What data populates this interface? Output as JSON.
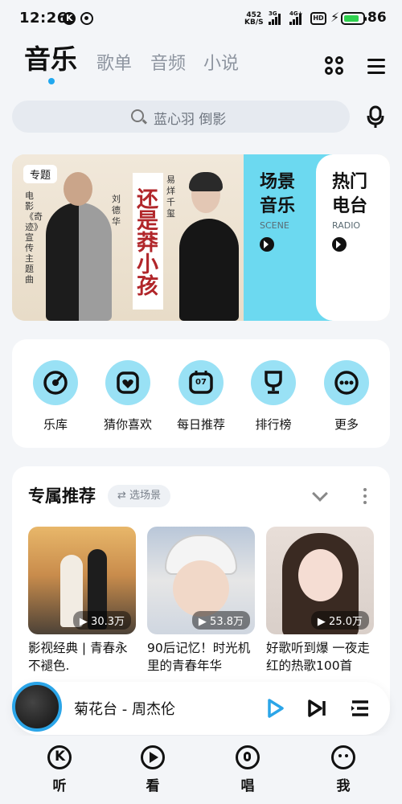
{
  "status_bar": {
    "time": "12:26",
    "speed_value": "452",
    "speed_unit": "KB/S",
    "net1": "3G",
    "net2": "4G+",
    "hd": "HD",
    "battery_percent": "86"
  },
  "top_tabs": [
    {
      "label": "音乐",
      "active": true
    },
    {
      "label": "歌单",
      "active": false
    },
    {
      "label": "音频",
      "active": false
    },
    {
      "label": "小说",
      "active": false
    }
  ],
  "search": {
    "placeholder": "蓝心羽 倒影"
  },
  "banner": {
    "badge": "专题",
    "vertical_caption": "电影《奇迹》宣传主题曲",
    "title": "还是莽小孩",
    "name_left": "刘德华",
    "name_right": "易烊千玺"
  },
  "categories": [
    {
      "title_line1": "场景",
      "title_line2": "音乐",
      "subtitle": "SCENE"
    },
    {
      "title_line1": "热门",
      "title_line2": "电台",
      "subtitle": "RADIO"
    }
  ],
  "quick_menu": [
    {
      "label": "乐库",
      "icon": "disc-icon"
    },
    {
      "label": "猜你喜欢",
      "icon": "heart-icon"
    },
    {
      "label": "每日推荐",
      "icon": "calendar-icon",
      "day": "07"
    },
    {
      "label": "排行榜",
      "icon": "trophy-icon"
    },
    {
      "label": "更多",
      "icon": "more-icon"
    }
  ],
  "recommend": {
    "title": "专属推荐",
    "chip": "⇄ 选场景",
    "cards": [
      {
        "play_count": "▶ 30.3万",
        "text": "影视经典 | 青春永不褪色."
      },
      {
        "play_count": "▶ 53.8万",
        "text": "90后记忆！时光机里的青春年华"
      },
      {
        "play_count": "▶ 25.0万",
        "text": "好歌听到爆 一夜走红的热歌100首"
      }
    ]
  },
  "now_playing": {
    "title": "菊花台 - 周杰伦"
  },
  "bottom_nav": [
    {
      "label": "听",
      "active": true
    },
    {
      "label": "看",
      "active": false
    },
    {
      "label": "唱",
      "active": false
    },
    {
      "label": "我",
      "active": false
    }
  ],
  "colors": {
    "accent": "#21a8ef",
    "scene_bg": "#6cd9f0",
    "quick_icon_bg": "#99e1f5"
  }
}
